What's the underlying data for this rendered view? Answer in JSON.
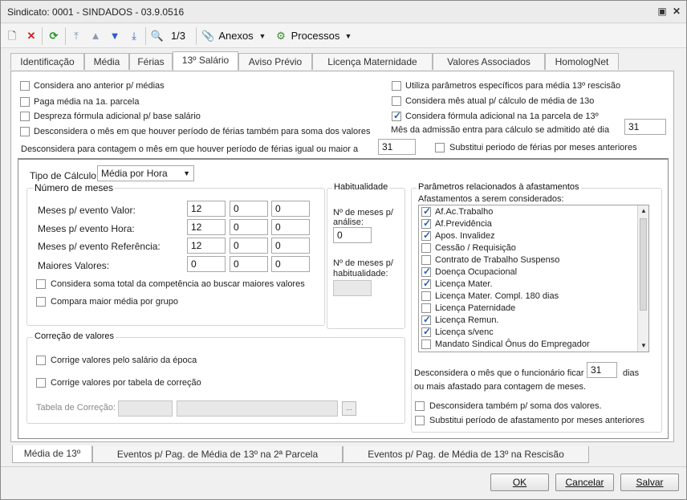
{
  "window": {
    "title": "Sindicato: 0001 - SINDADOS - 03.9.0516"
  },
  "toolbar": {
    "record_nav": "1/3",
    "anexos_label": "Anexos",
    "processos_label": "Processos"
  },
  "tabs": [
    "Identificação",
    "Média",
    "Férias",
    "13º Salário",
    "Aviso Prévio",
    "Licença Maternidade",
    "Valores Associados",
    "HomologNet"
  ],
  "top_options": {
    "considera_ano_anterior": "Considera ano anterior p/ médias",
    "paga_media_1a": "Paga média na 1a. parcela",
    "despreza_formula": "Despreza fórmula adicional p/ base salário",
    "desconsidera_ferias_soma": "Desconsidera o mês em que houver período de férias também para soma dos valores",
    "utiliza_parametros": "Utiliza parâmetros específicos para média 13º rescisão",
    "considera_mes_atual": "Considera mês atual  p/ cálculo de média de 13o",
    "considera_formula_1a": "Considera fórmula adicional na 1a parcela de 13º",
    "mes_admissao_label": "Mês da admissão entra para cálculo se admitido até dia",
    "mes_admissao_value": "31",
    "desconsidera_contagem_label": "Desconsidera para contagem o mês em que houver período de férias igual ou maior a",
    "desconsidera_contagem_value": "31",
    "substitui_ferias": "Substitui periodo de  férias por meses anteriores"
  },
  "tipo_calculo": {
    "label": "Tipo de Cálculo",
    "value": "Média por Hora"
  },
  "numero_meses": {
    "title": "Número de meses",
    "rows": [
      {
        "label": "Meses p/ evento Valor:",
        "v1": "12",
        "v2": "0",
        "v3": "0"
      },
      {
        "label": "Meses p/ evento Hora:",
        "v1": "12",
        "v2": "0",
        "v3": "0"
      },
      {
        "label": "Meses p/ evento Referência:",
        "v1": "12",
        "v2": "0",
        "v3": "0"
      },
      {
        "label": "Maiores Valores:",
        "v1": "0",
        "v2": "0",
        "v3": "0"
      }
    ],
    "considera_soma": "Considera soma total da competência ao buscar maiores valores",
    "compara_maior": "Compara maior média por grupo"
  },
  "habitualidade": {
    "title": "Habitualidade",
    "meses_analise_l1": "Nº de meses p/",
    "meses_analise_l2": "análise:",
    "meses_analise_value": "0",
    "meses_hab_l1": "Nº de meses p/",
    "meses_hab_l2": "habitualidade:",
    "meses_hab_value": ""
  },
  "correcao": {
    "title": "Correção de valores",
    "corrige_salario": "Corrige valores pelo salário da época",
    "corrige_tabela": "Corrige valores por tabela de correção",
    "tabela_label": "Tabela de Correção:",
    "browse": "..."
  },
  "afastamentos": {
    "title": "Parâmetros relacionados à afastamentos",
    "subtitle": "Afastamentos a serem considerados:",
    "items": [
      {
        "label": "Af.Ac.Trabalho",
        "checked": true
      },
      {
        "label": "Af.Previdência",
        "checked": true
      },
      {
        "label": "Apos. Invalidez",
        "checked": true
      },
      {
        "label": "Cessão / Requisição",
        "checked": false
      },
      {
        "label": "Contrato de Trabalho Suspenso",
        "checked": false
      },
      {
        "label": "Doença Ocupacional",
        "checked": true
      },
      {
        "label": "Licença Mater.",
        "checked": true
      },
      {
        "label": "Licença Mater. Compl. 180 dias",
        "checked": false
      },
      {
        "label": "Licença Paternidade",
        "checked": false
      },
      {
        "label": "Licença Remun.",
        "checked": true
      },
      {
        "label": "Licença s/venc",
        "checked": true
      },
      {
        "label": "Mandato Sindical Ônus do Empregador",
        "checked": false
      }
    ],
    "desconsidera_label": "Desconsidera o mês que o funcionário ficar",
    "desconsidera_value": "31",
    "dias": "dias",
    "ou_mais": "ou mais afastado para contagem de meses.",
    "desconsidera_soma": "Desconsidera também p/ soma dos valores.",
    "substitui_periodo": "Substitui período de afastamento por meses anteriores"
  },
  "bottom_tabs": [
    "Média de 13º",
    "Eventos p/ Pag. de Média de 13º na 2ª Parcela",
    "Eventos p/ Pag. de Média de 13º na Rescisão"
  ],
  "buttons": {
    "ok": "OK",
    "cancelar": "Cancelar",
    "salvar": "Salvar"
  }
}
